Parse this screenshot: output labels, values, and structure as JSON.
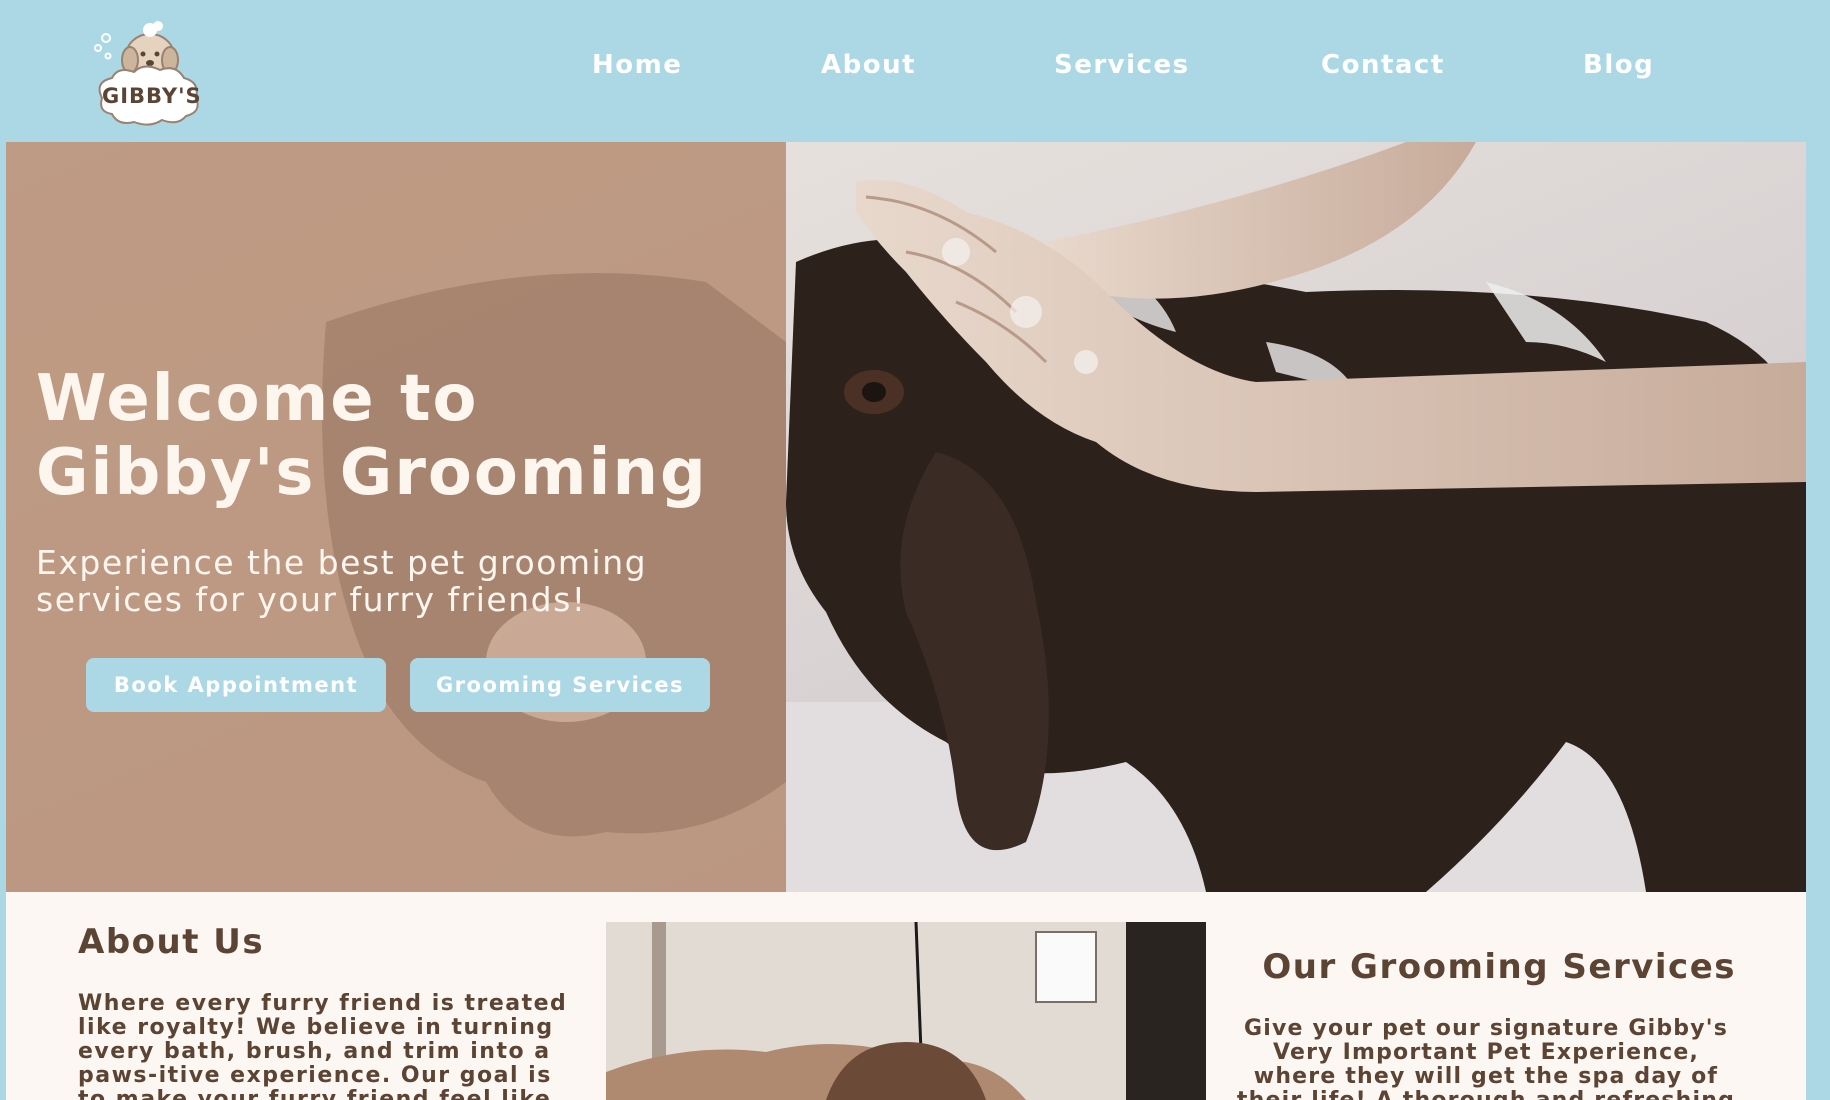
{
  "brand": {
    "logo_text": "GIBBY'S"
  },
  "nav": {
    "items": [
      {
        "label": "Home"
      },
      {
        "label": "About"
      },
      {
        "label": "Services"
      },
      {
        "label": "Contact"
      },
      {
        "label": "Blog"
      }
    ]
  },
  "hero": {
    "title": "Welcome to Gibby's Grooming",
    "subtitle": "Experience the best pet grooming services for your furry friends!",
    "book_button": "Book Appointment",
    "services_button": "Grooming Services"
  },
  "about": {
    "title": "About Us",
    "body": "Where every furry friend is treated like royalty! We believe in turning every bath, brush, and trim into a paws-itive experience. Our goal is to make your furry friend feel like the star they truly are."
  },
  "services": {
    "title": "Our Grooming Services",
    "body": "Give your pet our signature Gibby's Very Important Pet Experience, where they will get the spa day of their life! A thorough and refreshing full groom."
  },
  "colors": {
    "nav_bg": "#acd8e6",
    "hero_overlay": "#b78f76",
    "button_bg": "#acd8e6",
    "content_bg": "#fcf7f2",
    "text_brown": "#5c4435"
  }
}
